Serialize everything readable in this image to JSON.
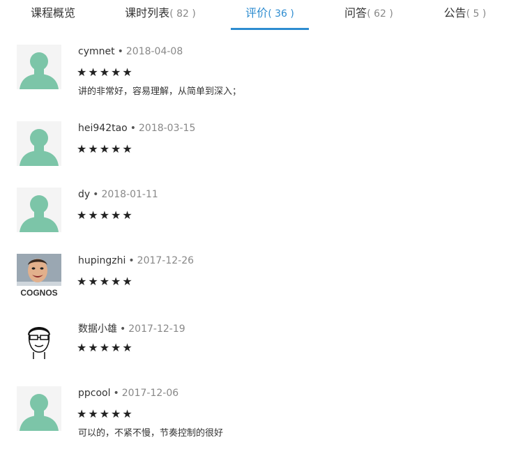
{
  "tabs": [
    {
      "label": "课程概览",
      "count": ""
    },
    {
      "label": "课时列表",
      "count": "( 82 )"
    },
    {
      "label": "评价",
      "count": "( 36 )"
    },
    {
      "label": "问答",
      "count": "( 62 )"
    },
    {
      "label": "公告",
      "count": "( 5 )"
    }
  ],
  "active_tab": "评价",
  "accent_color": "#2d8cd0",
  "reviews": [
    {
      "author": "cymnet",
      "date": "2018-04-08",
      "rating": 5,
      "stars": "★★★★★",
      "comment": "讲的非常好，容易理解，从简单到深入；",
      "avatar": "default-user-avatar"
    },
    {
      "author": "hei942tao",
      "date": "2018-03-15",
      "rating": 5,
      "stars": "★★★★★",
      "comment": "",
      "avatar": "default-user-avatar"
    },
    {
      "author": "dy",
      "date": "2018-01-11",
      "rating": 5,
      "stars": "★★★★★",
      "comment": "",
      "avatar": "default-user-avatar"
    },
    {
      "author": "hupingzhi",
      "date": "2017-12-26",
      "rating": 5,
      "stars": "★★★★★",
      "comment": "",
      "avatar": "photo-avatar",
      "avatar_text": "COGNOS"
    },
    {
      "author": "数据小雄",
      "date": "2017-12-19",
      "rating": 5,
      "stars": "★★★★★",
      "comment": "",
      "avatar": "sketch-avatar"
    },
    {
      "author": "ppcool",
      "date": "2017-12-06",
      "rating": 5,
      "stars": "★★★★★",
      "comment": "可以的，不紧不慢，节奏控制的很好",
      "avatar": "default-user-avatar"
    }
  ],
  "separator": "•"
}
